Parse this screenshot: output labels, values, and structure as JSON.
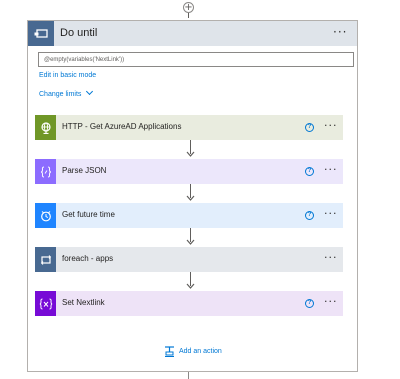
{
  "loop": {
    "title": "Do until",
    "condition": "@empty(variables('NextLink'))",
    "edit_basic_mode": "Edit in basic mode",
    "change_limits": "Change limits",
    "header_color": "#486991",
    "more": "···"
  },
  "actions": [
    {
      "label": "HTTP - Get AzureAD Applications",
      "icon": "globe-icon",
      "icon_bg": "#709727",
      "bg": "#e9ecdf",
      "has_help": true
    },
    {
      "label": "Parse JSON",
      "icon": "curly-braces-icon",
      "icon_bg": "#8c6cff",
      "bg": "#ece7fb",
      "has_help": true
    },
    {
      "label": "Get future time",
      "icon": "clock-icon",
      "icon_bg": "#1f85ff",
      "bg": "#e2eefc",
      "has_help": true
    },
    {
      "label": "foreach - apps",
      "icon": "loop-icon",
      "icon_bg": "#486991",
      "bg": "#e5e8ec",
      "has_help": false
    },
    {
      "label": "Set Nextlink",
      "icon": "variable-icon",
      "icon_bg": "#770bd6",
      "bg": "#eee3f7",
      "has_help": true
    }
  ],
  "help_glyph": "?",
  "add_action": "Add an action",
  "top_plus": "+"
}
